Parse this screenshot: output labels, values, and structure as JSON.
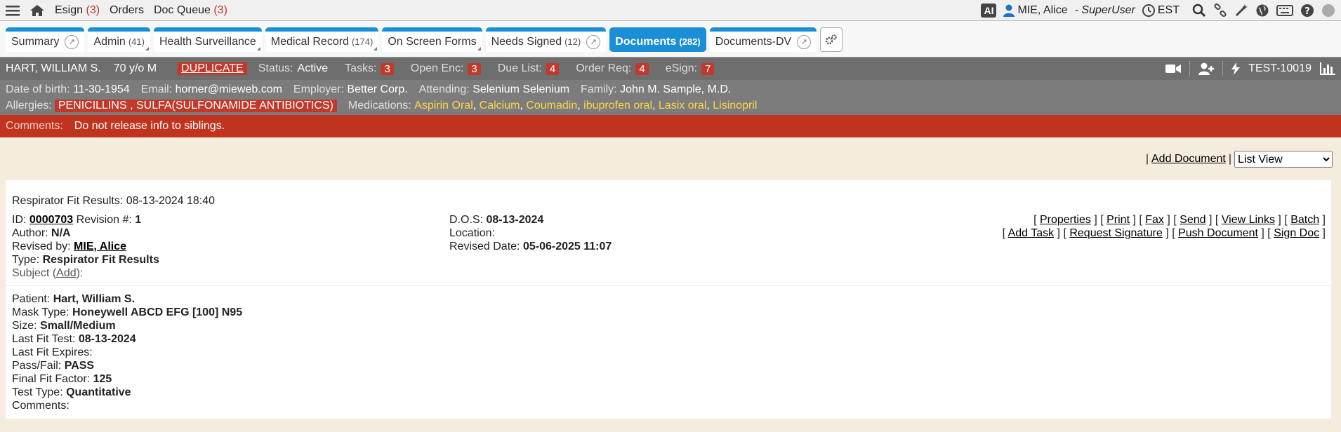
{
  "topbar": {
    "esign_label": "Esign",
    "esign_count": "(3)",
    "orders_label": "Orders",
    "docqueue_label": "Doc Queue",
    "docqueue_count": "(3)",
    "ai_label": "AI",
    "user_name": "MIE, Alice",
    "user_role": "- SuperUser",
    "timezone": "EST"
  },
  "tabs": [
    {
      "label": "Summary",
      "count": ""
    },
    {
      "label": "Admin",
      "count": "(41)"
    },
    {
      "label": "Health Surveillance",
      "count": ""
    },
    {
      "label": "Medical Record",
      "count": "(174)"
    },
    {
      "label": "On Screen Forms",
      "count": ""
    },
    {
      "label": "Needs Signed",
      "count": "(12)"
    },
    {
      "label": "Documents",
      "count": "(282)"
    },
    {
      "label": "Documents-DV",
      "count": ""
    }
  ],
  "patient": {
    "name": "HART, WILLIAM S.",
    "age_sex": "70 y/o M",
    "duplicate": "DUPLICATE",
    "status_label": "Status:",
    "status": "Active",
    "tasks_label": "Tasks:",
    "tasks": "3",
    "open_enc_label": "Open Enc:",
    "open_enc": "3",
    "due_list_label": "Due List:",
    "due_list": "4",
    "order_req_label": "Order Req:",
    "order_req": "4",
    "esign_label": "eSign:",
    "esign": "7",
    "test_id": "TEST-10019",
    "dob_label": "Date of birth:",
    "dob": "11-30-1954",
    "email_label": "Email:",
    "email": "horner@mieweb.com",
    "employer_label": "Employer:",
    "employer": "Better Corp.",
    "attending_label": "Attending:",
    "attending": "Selenium Selenium",
    "family_label": "Family:",
    "family": "John M. Sample, M.D.",
    "allergies_label": "Allergies:",
    "allergies": "PENICILLINS , SULFA(SULFONAMIDE ANTIBIOTICS)",
    "medications_label": "Medications:",
    "medications": [
      "Aspirin Oral",
      "Calcium",
      "Coumadin",
      "ibuprofen oral",
      "Lasix oral",
      "Lisinopril"
    ],
    "comments_label": "Comments:",
    "comments": "Do not release info to siblings."
  },
  "actions": {
    "add_document": "Add Document",
    "view_selected": "List View",
    "view_options": [
      "List View"
    ]
  },
  "document": {
    "title": "Respirator Fit Results: 08-13-2024 18:40",
    "id_label": "ID:",
    "id": "0000703",
    "revision_label": "Revision #:",
    "revision": "1",
    "author_label": "Author:",
    "author": "N/A",
    "revised_by_label": "Revised by:",
    "revised_by": "MIE, Alice",
    "type_label": "Type:",
    "type": "Respirator Fit Results",
    "subject_label": "Subject (",
    "subject_add": "Add",
    "subject_tail": "):",
    "dos_label": "D.O.S:",
    "dos": "08-13-2024",
    "location_label": "Location:",
    "revised_date_label": "Revised Date:",
    "revised_date": "05-06-2025 11:07",
    "links_row1": [
      "Properties",
      "Print",
      "Fax",
      "Send",
      "View Links",
      "Batch"
    ],
    "links_row2": [
      "Add Task",
      "Request Signature",
      "Push Document",
      "Sign Doc"
    ],
    "fields": [
      {
        "label": "Patient:",
        "value": "Hart, William S."
      },
      {
        "label": "Mask Type:",
        "value": "Honeywell ABCD EFG [100] N95"
      },
      {
        "label": "Size:",
        "value": "Small/Medium"
      },
      {
        "label": "Last Fit Test:",
        "value": "08-13-2024"
      },
      {
        "label": "Last Fit Expires:",
        "value": ""
      },
      {
        "label": "Pass/Fail:",
        "value": "PASS"
      },
      {
        "label": "Final Fit Factor:",
        "value": "125"
      },
      {
        "label": "Test Type:",
        "value": "Quantitative"
      },
      {
        "label": "Comments:",
        "value": ""
      }
    ]
  }
}
